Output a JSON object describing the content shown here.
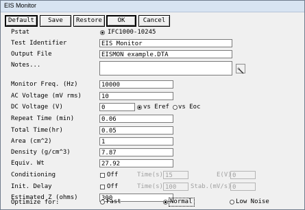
{
  "window": {
    "title": "EIS Monitor"
  },
  "buttons": {
    "default": "Default",
    "save": "Save",
    "restore": "Restore",
    "ok": "OK",
    "cancel": "Cancel"
  },
  "pstat": {
    "label": "Pstat",
    "option": "IFC1000-10245",
    "selected": true
  },
  "test_identifier": {
    "label": "Test Identifier",
    "value": "EIS Monitor"
  },
  "output_file": {
    "label": "Output File",
    "value": "EISMON example.DTA"
  },
  "notes": {
    "label": "Notes...",
    "value": ""
  },
  "monitor_freq": {
    "label": "Monitor Freq. (Hz)",
    "value": "10000"
  },
  "ac_voltage": {
    "label": "AC Voltage (mV rms)",
    "value": "10"
  },
  "dc_voltage": {
    "label": "DC Voltage (V)",
    "value": "0",
    "vs_eref": "vs Eref",
    "vs_eoc": "vs Eoc",
    "selected": "vs Eref"
  },
  "repeat_time": {
    "label": "Repeat Time (min)",
    "value": "0.06"
  },
  "total_time": {
    "label": "Total Time(hr)",
    "value": "0.05"
  },
  "area": {
    "label": "Area (cm^2)",
    "value": "1"
  },
  "density": {
    "label": "Density (g/cm^3)",
    "value": "7.87"
  },
  "equiv_wt": {
    "label": "Equiv. Wt",
    "value": "27.92"
  },
  "conditioning": {
    "label": "Conditioning",
    "check_label": "Off",
    "checked": false,
    "time_label": "Time(s)",
    "time_value": "15",
    "e_label": "E(V)",
    "e_value": "0"
  },
  "init_delay": {
    "label": "Init. Delay",
    "check_label": "Off",
    "checked": false,
    "time_label": "Time(s)",
    "time_value": "100",
    "stab_label": "Stab.(mV/s)",
    "stab_value": "0"
  },
  "estimated_z": {
    "label": "Estimated Z (ohms)",
    "value": "300"
  },
  "optimize": {
    "label": "Optimize for:",
    "fast": "Fast",
    "normal": "Normal",
    "low_noise": "Low Noise",
    "selected": "Normal"
  }
}
